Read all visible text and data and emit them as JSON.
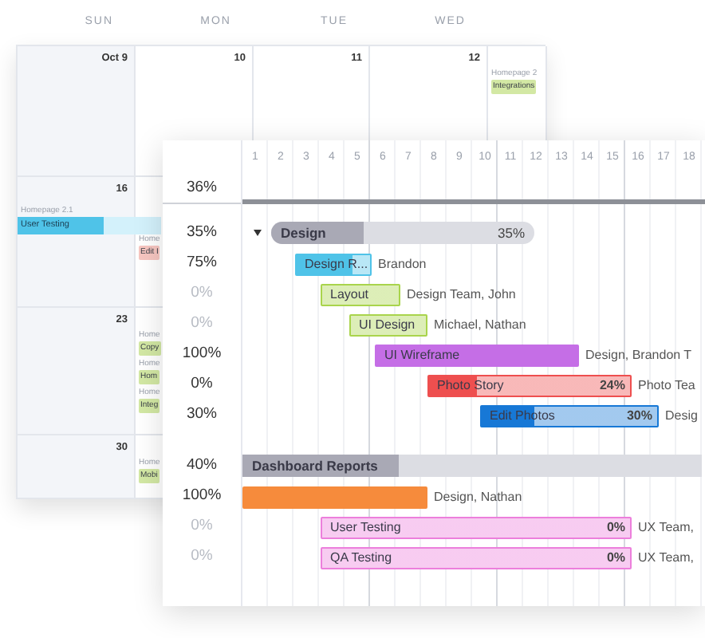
{
  "calendar": {
    "weekdays": [
      "SUN",
      "MON",
      "TUE",
      "WED"
    ],
    "weeks": [
      {
        "cells": [
          {
            "date": "Oct 9"
          },
          {
            "date": "10"
          },
          {
            "date": "11"
          },
          {
            "date": "12"
          },
          {
            "events": [
              {
                "kind": "label",
                "text": "Homepage 2"
              },
              {
                "kind": "chip",
                "text": "Integrations",
                "color": "#d3e8a4"
              }
            ]
          }
        ]
      },
      {
        "cells": [
          {
            "date": "16",
            "events": [
              {
                "kind": "label",
                "text": "Homepage 2.1"
              },
              {
                "kind": "bar",
                "text": "User Testing",
                "color": "#4fc3e8",
                "level": 0.6
              }
            ]
          },
          {
            "events": [
              {
                "kind": "label",
                "text": "Home"
              },
              {
                "kind": "chip",
                "text": "Edit I",
                "color": "#f7c6c1"
              }
            ]
          }
        ]
      },
      {
        "cells": [
          {
            "date": "23"
          },
          {
            "events": [
              {
                "kind": "label",
                "text": "Home"
              },
              {
                "kind": "chip",
                "text": "Copy",
                "color": "#d3e8a4"
              },
              {
                "kind": "label",
                "text": "Home"
              },
              {
                "kind": "chip",
                "text": "Hom",
                "color": "#d3e8a4"
              },
              {
                "kind": "label",
                "text": "Home"
              },
              {
                "kind": "chip",
                "text": "Integ",
                "color": "#d3e8a4"
              }
            ]
          }
        ]
      },
      {
        "cells": [
          {
            "date": "30"
          },
          {
            "events": [
              {
                "kind": "label",
                "text": "Home"
              },
              {
                "kind": "chip",
                "text": "Mobi",
                "color": "#d3e8a4"
              }
            ]
          }
        ]
      }
    ]
  },
  "gantt": {
    "days": [
      "1",
      "2",
      "3",
      "4",
      "5",
      "6",
      "7",
      "8",
      "9",
      "10",
      "11",
      "12",
      "13",
      "14",
      "15",
      "16",
      "17",
      "18"
    ],
    "total": {
      "percent": "36%"
    },
    "groups": [
      {
        "name": "Design",
        "percent": "35%",
        "bar_label": "35%",
        "level": 0.35,
        "expanded": true,
        "tasks": [
          {
            "name": "Design R...",
            "percent": "75%",
            "level": 0.75,
            "color": "#4fc3e8",
            "assignee": "Brandon"
          },
          {
            "name": "Layout",
            "percent": "0%",
            "color": "#a9d44c",
            "assignee": "Design Team, John"
          },
          {
            "name": "UI Design",
            "percent": "0%",
            "color": "#a9d44c",
            "assignee": "Michael, Nathan"
          },
          {
            "name": "UI Wireframe",
            "percent": "100%",
            "level": 1,
            "color": "#c56ee6",
            "assignee": "Design, Brandon T"
          },
          {
            "name": "Photo Story",
            "percent": "0%",
            "level": 0.24,
            "color": "#ee4f4f",
            "bar_label": "24%",
            "assignee": "Photo Tea"
          },
          {
            "name": "Edit Photos",
            "percent": "30%",
            "level": 0.3,
            "color": "#1778d6",
            "bar_label": "30%",
            "assignee": "Desig"
          }
        ]
      },
      {
        "name": "Dashboard Reports",
        "percent": "40%",
        "level": 0.34,
        "expanded": false,
        "tasks": [
          {
            "percent": "100%",
            "level": 1,
            "color": "#f68b3c",
            "assignee": "Design, Nathan"
          },
          {
            "name": "User Testing",
            "percent": "0%",
            "color": "#ec7fdc",
            "bar_label": "0%",
            "assignee": "UX Team,"
          },
          {
            "name": "QA Testing",
            "percent": "0%",
            "color": "#ec7fdc",
            "bar_label": "0%",
            "assignee": "UX Team,"
          }
        ]
      }
    ]
  }
}
